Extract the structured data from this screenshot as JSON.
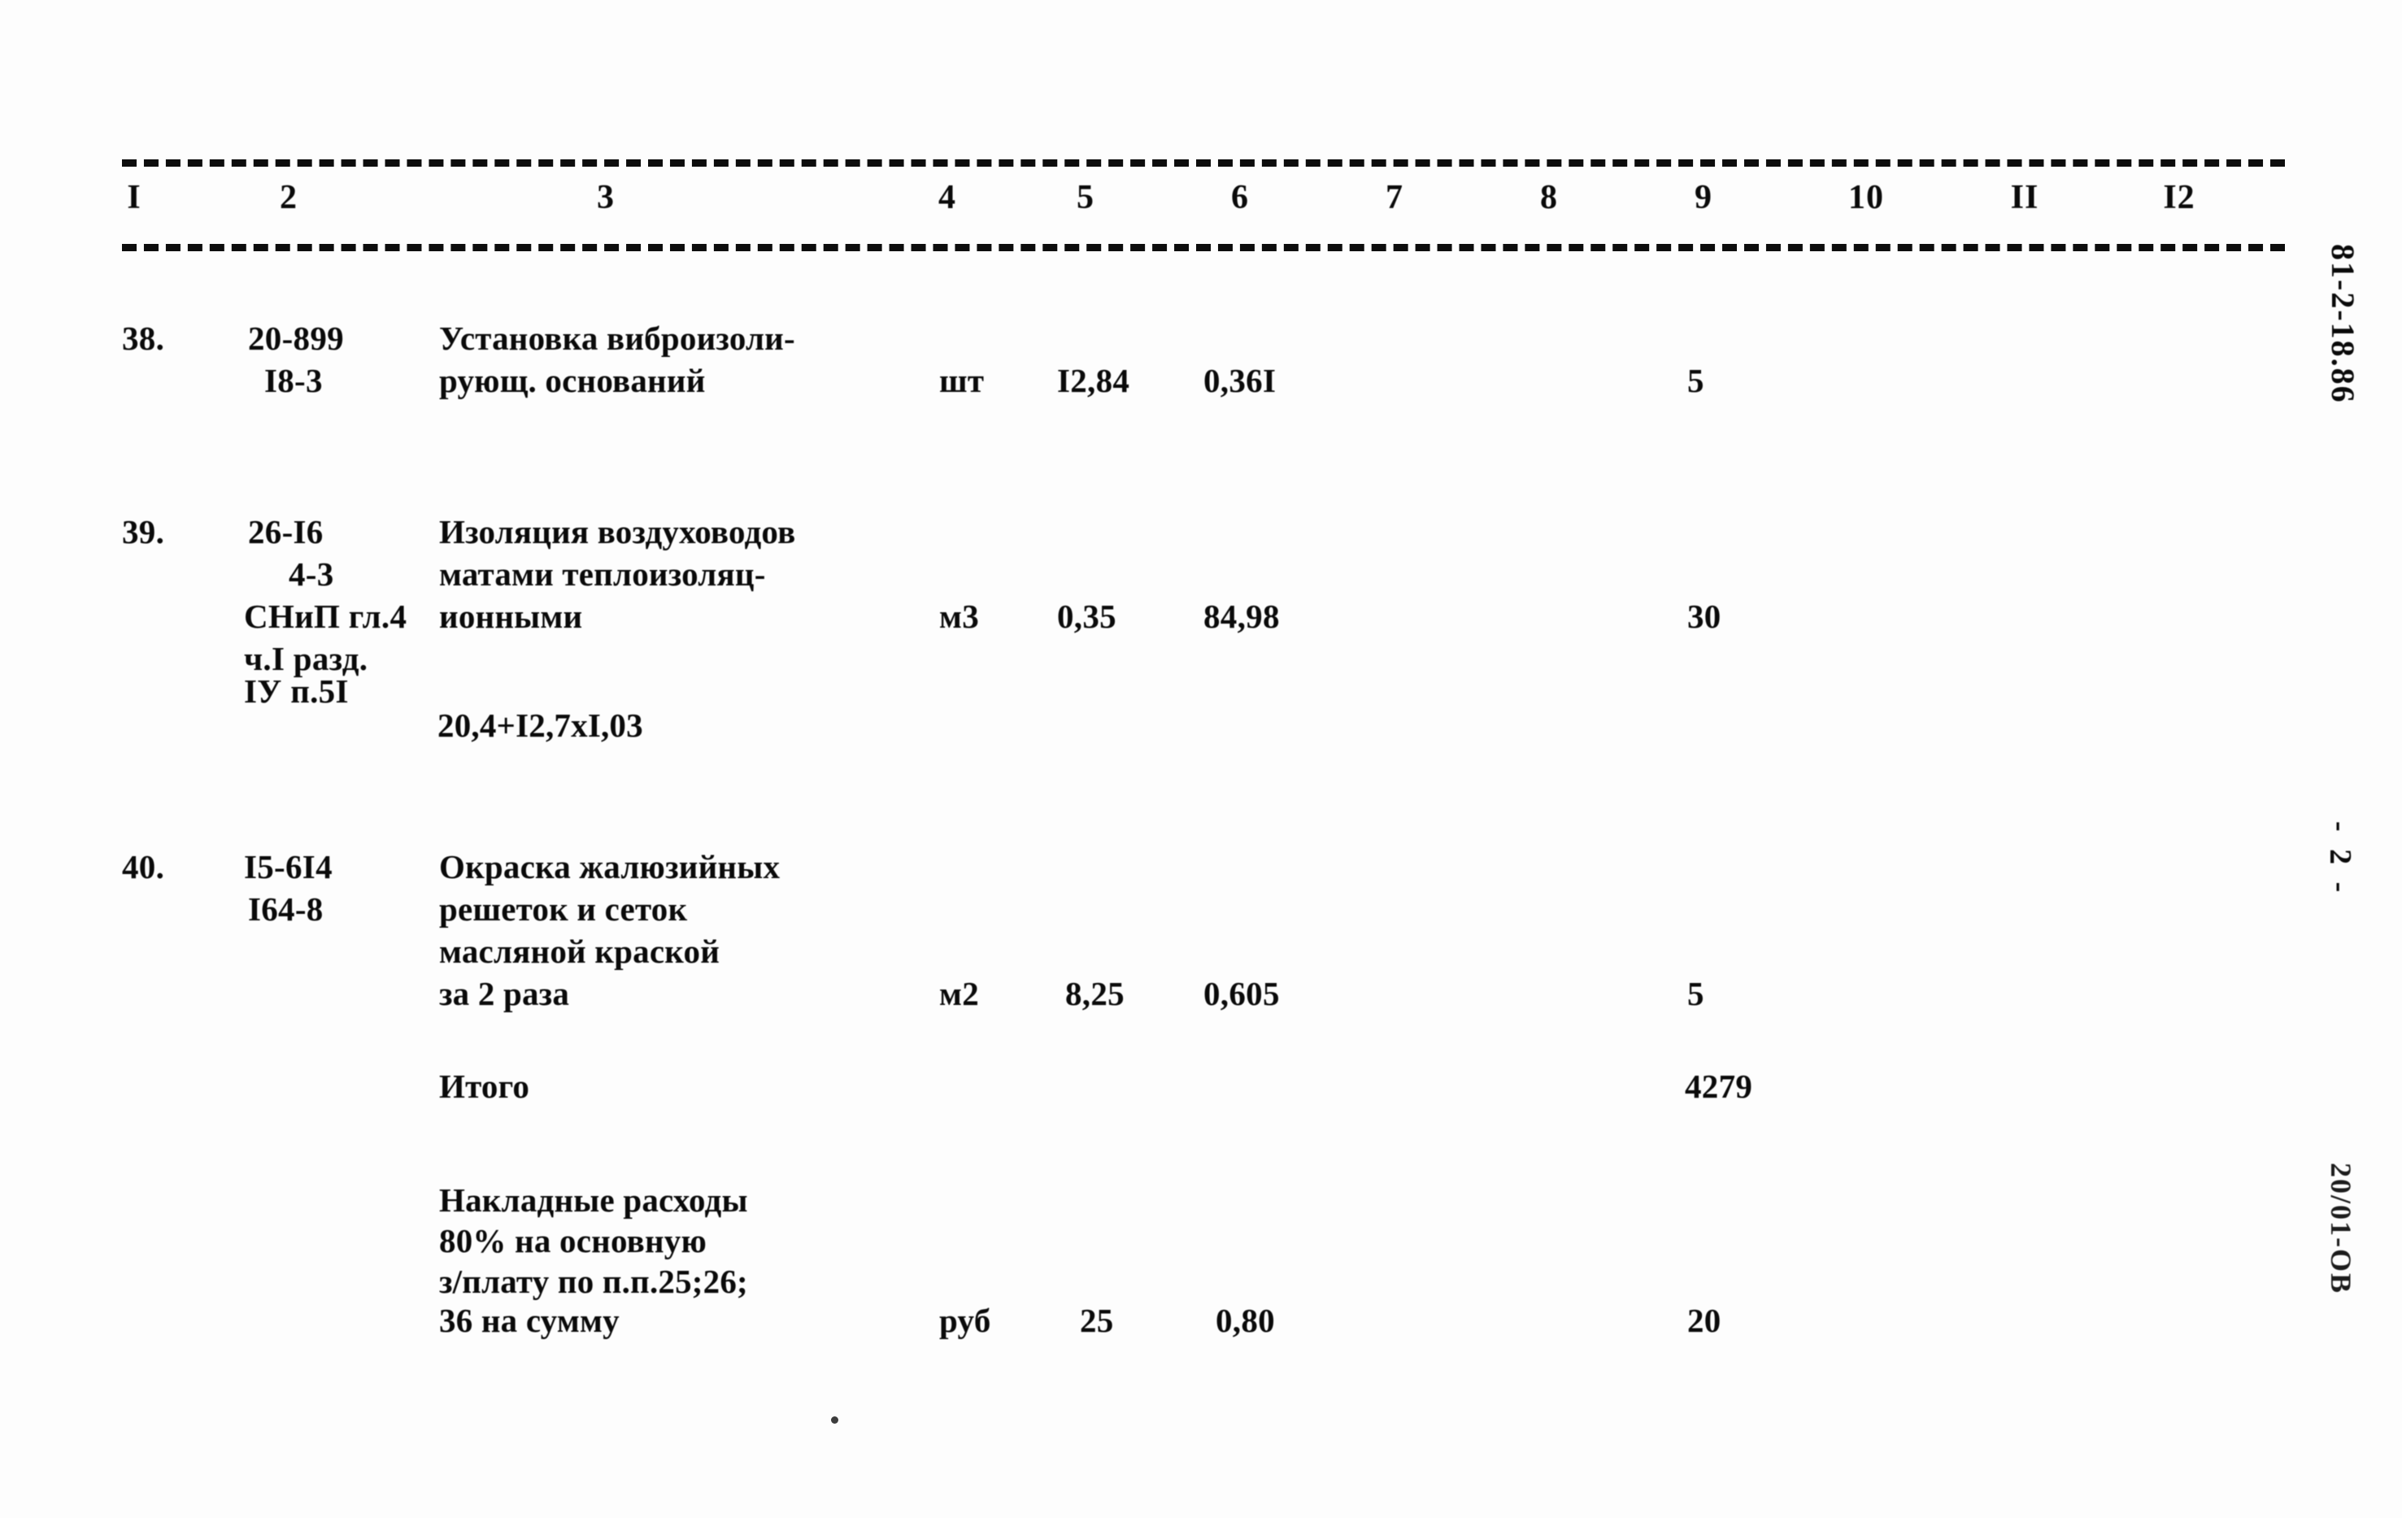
{
  "document": {
    "kind": "construction-estimate-table",
    "language": "ru"
  },
  "table": {
    "column_headers": [
      "I",
      "2",
      "3",
      "4",
      "5",
      "6",
      "7",
      "8",
      "9",
      "10",
      "II",
      "I2"
    ],
    "rows": [
      {
        "no": "38.",
        "code_lines": [
          "20-899",
          "I8-3"
        ],
        "description_lines": [
          "Установка виброизоли-",
          "рующ. оснований"
        ],
        "unit": "шт",
        "qty": "I2,84",
        "price": "0,36I",
        "total": "5"
      },
      {
        "no": "39.",
        "code_lines": [
          "26-I6",
          "4-3",
          "СНиП гл.4",
          "ч.I разд.",
          "IУ п.5I"
        ],
        "description_lines": [
          "Изоляция воздуховодов",
          "матами теплоизоляц-",
          "ионными"
        ],
        "formula": "20,4+I2,7xI,03",
        "unit": "м3",
        "qty": "0,35",
        "price": "84,98",
        "total": "30"
      },
      {
        "no": "40.",
        "code_lines": [
          "I5-6I4",
          "I64-8"
        ],
        "description_lines": [
          "Окраска жалюзийных",
          "решеток и сеток",
          "масляной краской",
          "за 2 раза"
        ],
        "unit": "м2",
        "qty": "8,25",
        "price": "0,605",
        "total": "5"
      }
    ],
    "subtotal": {
      "label": "Итого",
      "value": "4279"
    },
    "overhead": {
      "description_lines": [
        "Накладные расходы",
        "80% на основную",
        "з/плату по п.п.25;26;",
        "36 на сумму"
      ],
      "unit": "руб",
      "qty": "25",
      "price": "0,80",
      "total": "20"
    }
  },
  "margins": {
    "code_stamp": "81-2-18.86",
    "page_stamp": "- 2 -",
    "doc_stamp": "20/01-ОВ"
  }
}
